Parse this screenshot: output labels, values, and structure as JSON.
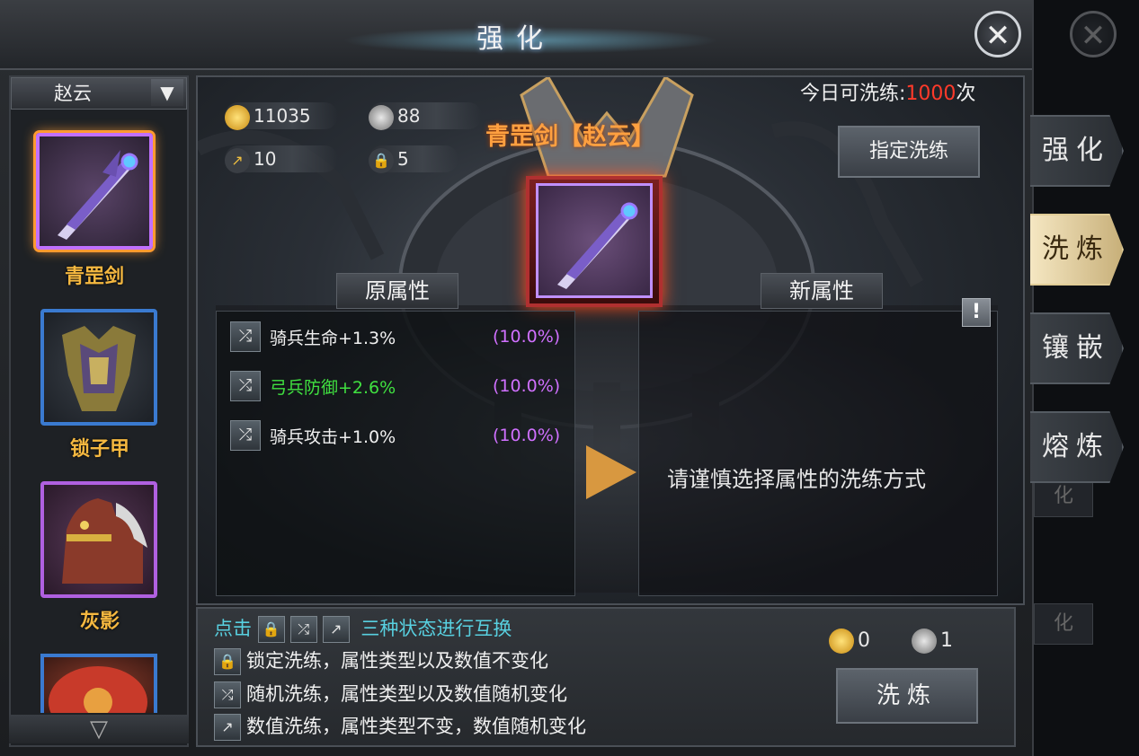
{
  "window": {
    "title": "强化",
    "close_icon": "close-icon"
  },
  "hero_select": {
    "value": "赵云",
    "dropdown_icon": "chevron-down-icon"
  },
  "item_list": {
    "items": [
      {
        "name": "青罡剑",
        "rarity_color": "#c070ff",
        "selected": true,
        "icon": "sword-icon"
      },
      {
        "name": "锁子甲",
        "rarity_color": "#3a7ad0",
        "selected": false,
        "icon": "armor-icon"
      },
      {
        "name": "灰影",
        "rarity_color": "#b060e0",
        "selected": false,
        "icon": "horse-icon"
      },
      {
        "name": "",
        "rarity_color": "#3a7ad0",
        "selected": false,
        "icon": "cloak-icon"
      }
    ],
    "scroll_down_icon": "chevron-down-icon"
  },
  "resources": {
    "gold": "11035",
    "stone": "88",
    "refine_item": "10",
    "lock_item": "5"
  },
  "daily_limit": {
    "label": "今日可洗练:",
    "value": "1000",
    "unit": "次"
  },
  "assign_button": "指定洗练",
  "item_title": "青罡剑【赵云】",
  "headers": {
    "old": "原属性",
    "new": "新属性"
  },
  "old_attributes": [
    {
      "text": "骑兵生命+1.3%",
      "pct": "(10.0%)",
      "color": "#f0f0f0"
    },
    {
      "text": "弓兵防御+2.6%",
      "pct": "(10.0%)",
      "color": "#40e040"
    },
    {
      "text": "骑兵攻击+1.0%",
      "pct": "(10.0%)",
      "color": "#f0f0f0"
    }
  ],
  "hint": "请谨慎选择属性的洗练方式",
  "info_button": "!",
  "legend": {
    "prefix": "点击",
    "title_suffix": "三种状态进行互换",
    "rows": [
      {
        "icon": "lock-icon",
        "text": "锁定洗练，属性类型以及数值不变化"
      },
      {
        "icon": "shuffle-icon",
        "text": "随机洗练，属性类型以及数值随机变化"
      },
      {
        "icon": "trend-icon",
        "text": "数值洗练，属性类型不变，数值随机变化"
      }
    ]
  },
  "cost": {
    "gold": "0",
    "stone": "1"
  },
  "refine_button": "洗炼",
  "side_tabs": [
    {
      "label": "强化",
      "active": false
    },
    {
      "label": "洗炼",
      "active": true
    },
    {
      "label": "镶嵌",
      "active": false
    },
    {
      "label": "熔炼",
      "active": false
    }
  ],
  "ghost_tabs": [
    "化",
    "化"
  ]
}
